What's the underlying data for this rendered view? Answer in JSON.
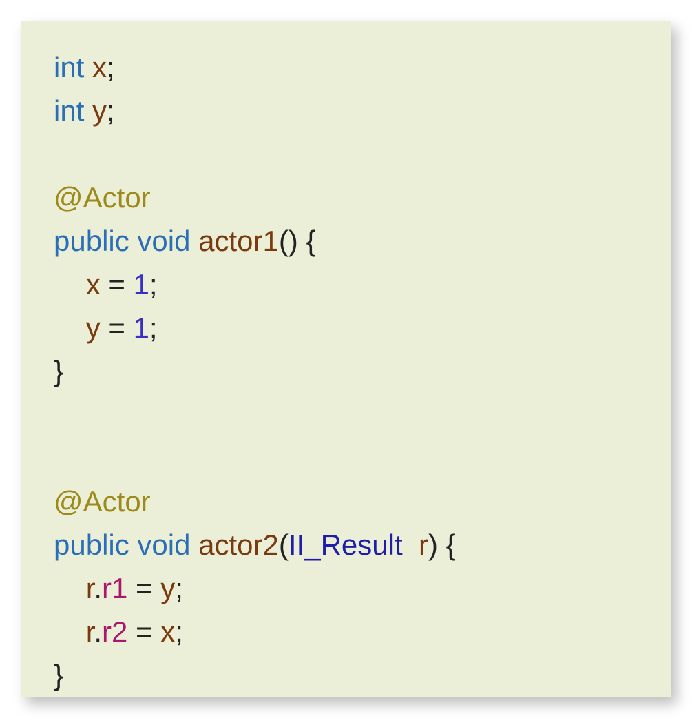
{
  "colors": {
    "background": "#ecefd8",
    "keyword": "#2a6fb5",
    "annotation": "#9c8a1b",
    "identifier": "#7a3a0f",
    "field": "#a8186c",
    "type": "#1e1eaa",
    "number": "#3b2fc3",
    "punct": "#222222"
  },
  "code": {
    "lines": [
      [
        {
          "t": "int",
          "c": "kw"
        },
        {
          "t": " ",
          "c": "pun"
        },
        {
          "t": "x",
          "c": "id"
        },
        {
          "t": ";",
          "c": "pun"
        }
      ],
      [
        {
          "t": "int",
          "c": "kw"
        },
        {
          "t": " ",
          "c": "pun"
        },
        {
          "t": "y",
          "c": "id"
        },
        {
          "t": ";",
          "c": "pun"
        }
      ],
      [],
      [
        {
          "t": "@Actor",
          "c": "ann"
        }
      ],
      [
        {
          "t": "public",
          "c": "kw"
        },
        {
          "t": " ",
          "c": "pun"
        },
        {
          "t": "void",
          "c": "kw"
        },
        {
          "t": " ",
          "c": "pun"
        },
        {
          "t": "actor1",
          "c": "id"
        },
        {
          "t": "()",
          "c": "pun"
        },
        {
          "t": " {",
          "c": "pun"
        }
      ],
      [
        {
          "t": "    ",
          "c": "pun"
        },
        {
          "t": "x",
          "c": "id"
        },
        {
          "t": " = ",
          "c": "pun"
        },
        {
          "t": "1",
          "c": "num"
        },
        {
          "t": ";",
          "c": "pun"
        }
      ],
      [
        {
          "t": "    ",
          "c": "pun"
        },
        {
          "t": "y",
          "c": "id"
        },
        {
          "t": " = ",
          "c": "pun"
        },
        {
          "t": "1",
          "c": "num"
        },
        {
          "t": ";",
          "c": "pun"
        }
      ],
      [
        {
          "t": "}",
          "c": "pun"
        }
      ],
      [],
      [],
      [
        {
          "t": "@Actor",
          "c": "ann"
        }
      ],
      [
        {
          "t": "public",
          "c": "kw"
        },
        {
          "t": " ",
          "c": "pun"
        },
        {
          "t": "void",
          "c": "kw"
        },
        {
          "t": " ",
          "c": "pun"
        },
        {
          "t": "actor2",
          "c": "id"
        },
        {
          "t": "(",
          "c": "pun"
        },
        {
          "t": "II_Result",
          "c": "typ"
        },
        {
          "t": "  ",
          "c": "pun"
        },
        {
          "t": "r",
          "c": "id"
        },
        {
          "t": ")",
          "c": "pun"
        },
        {
          "t": " {",
          "c": "pun"
        }
      ],
      [
        {
          "t": "    ",
          "c": "pun"
        },
        {
          "t": "r",
          "c": "id"
        },
        {
          "t": ".",
          "c": "pun"
        },
        {
          "t": "r1",
          "c": "fld"
        },
        {
          "t": " = ",
          "c": "pun"
        },
        {
          "t": "y",
          "c": "id"
        },
        {
          "t": ";",
          "c": "pun"
        }
      ],
      [
        {
          "t": "    ",
          "c": "pun"
        },
        {
          "t": "r",
          "c": "id"
        },
        {
          "t": ".",
          "c": "pun"
        },
        {
          "t": "r2",
          "c": "fld"
        },
        {
          "t": " = ",
          "c": "pun"
        },
        {
          "t": "x",
          "c": "id"
        },
        {
          "t": ";",
          "c": "pun"
        }
      ],
      [
        {
          "t": "}",
          "c": "pun"
        }
      ]
    ]
  }
}
